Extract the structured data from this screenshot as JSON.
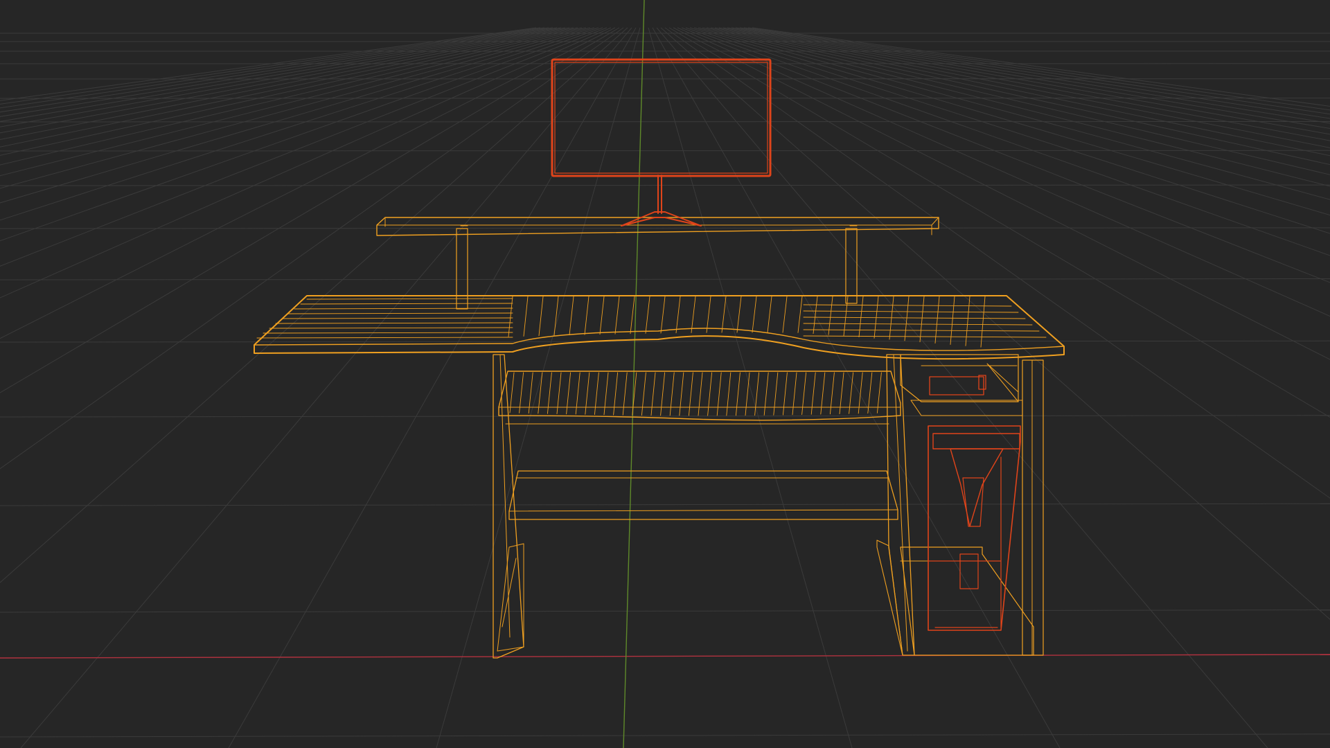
{
  "viewport": {
    "mode": "wireframe",
    "background_color": "#262626",
    "grid_color": "#3b3b3b",
    "axis_x_color": "#b2323f",
    "axis_y_color": "#5f8a2a",
    "selected_color": "#f0a020",
    "active_color": "#e0441a"
  },
  "scene": {
    "objects": [
      {
        "name": "desk",
        "selection": "selected"
      },
      {
        "name": "monitor",
        "selection": "active"
      },
      {
        "name": "computer-tower",
        "selection": "active"
      }
    ]
  }
}
